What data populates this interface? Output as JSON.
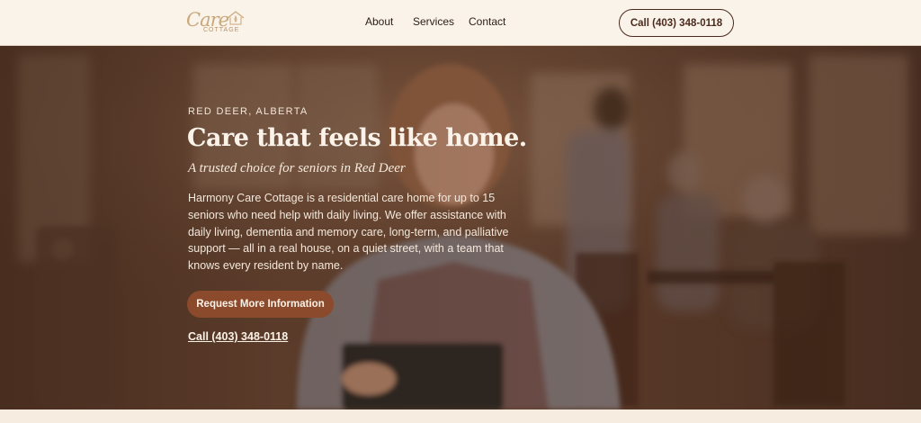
{
  "header": {
    "logo": {
      "script": "Care",
      "sub": "COTTAGE"
    },
    "nav": [
      {
        "label": "About"
      },
      {
        "label": "Services"
      },
      {
        "label": "Contact"
      }
    ],
    "call_button": "Call (403) 348-0118"
  },
  "hero": {
    "eyebrow": "RED DEER, ALBERTA",
    "headline": "Care that feels like home.",
    "subheadline": "A trusted choice for seniors in Red Deer",
    "body": "Harmony Care Cottage is a residential care home for up to 15 seniors who need help with daily living. We offer assistance with daily living, dementia and memory care, long-term, and palliative support — all in a real house, on a quiet street, with a team that knows every resident by name.",
    "cta": "Request More Information",
    "phone_link": "Call (403) 348-0118"
  },
  "colors": {
    "accent": "#8b4a2c",
    "header_bg": "#faf3e9",
    "dark_brown": "#4a2a1c",
    "logo_gold": "#c9a77a"
  }
}
